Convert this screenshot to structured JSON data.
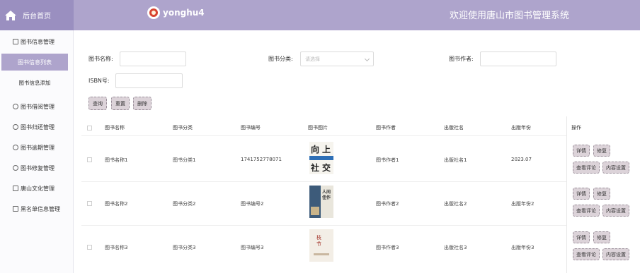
{
  "header": {
    "home_label": "后台首页",
    "username": "yonghu4",
    "system_title": "欢迎使用唐山市图书管理系统",
    "accent": "#aea4cc"
  },
  "sidebar": {
    "items": [
      {
        "label": "图书信息管理",
        "icon": "book-icon"
      },
      {
        "label": "图书借阅管理",
        "icon": "refresh-icon"
      },
      {
        "label": "图书归还管理",
        "icon": "star-icon"
      },
      {
        "label": "图书逾期管理",
        "icon": "clock-icon"
      },
      {
        "label": "图书修复管理",
        "icon": "palette-icon"
      },
      {
        "label": "唐山文化管理",
        "icon": "building-icon"
      },
      {
        "label": "黑名单信息管理",
        "icon": "list-icon"
      }
    ],
    "sub_items": [
      {
        "label": "图书信息列表",
        "active": true
      },
      {
        "label": "图书信息添加",
        "active": false
      }
    ]
  },
  "search": {
    "name_label": "图书名称:",
    "category_label": "图书分类:",
    "category_placeholder": "请选择",
    "author_label": "图书作者:",
    "isbn_label": "ISBN号:",
    "query_button": "查询",
    "reset_button": "重置",
    "delete_button": "删除"
  },
  "table": {
    "headers": [
      "图书名称",
      "图书分类",
      "图书编号",
      "图书图片",
      "图书作者",
      "出版社名",
      "出版年份",
      "操作"
    ],
    "rows": [
      {
        "name": "图书名称1",
        "category": "图书分类1",
        "code": "1741752778071",
        "author": "图书作者1",
        "publisher": "出版社名1",
        "year": "2023.07"
      },
      {
        "name": "图书名称2",
        "category": "图书分类2",
        "code": "图书编号2",
        "author": "图书作者2",
        "publisher": "出版社名2",
        "year": "出版年份2"
      },
      {
        "name": "图书名称3",
        "category": "图书分类3",
        "code": "图书编号3",
        "author": "图书作者3",
        "publisher": "出版社名3",
        "year": "出版年份3"
      }
    ],
    "actions": {
      "detail": "详情",
      "edit": "修复",
      "comments": "查看评论",
      "content": "内容设置"
    },
    "covers": [
      {
        "chars": [
          "向",
          "上",
          "社",
          "交"
        ]
      },
      {
        "chars": [
          "人",
          "间",
          "佳",
          "作"
        ]
      },
      {
        "chars": [
          "枝",
          "节"
        ]
      }
    ]
  }
}
